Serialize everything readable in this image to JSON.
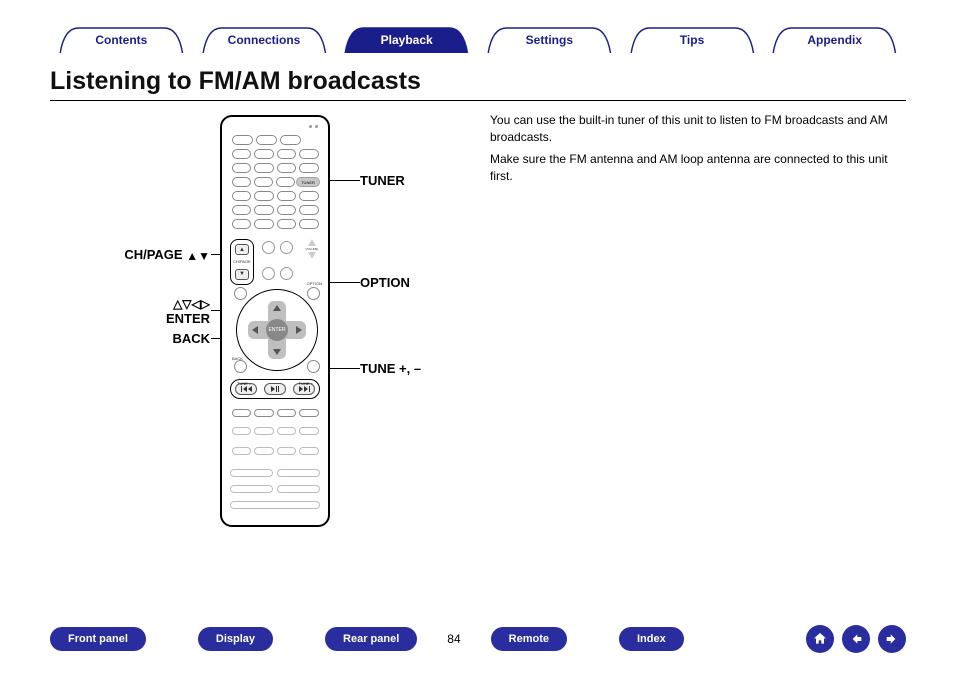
{
  "tabs": {
    "contents": "Contents",
    "connections": "Connections",
    "playback": "Playback",
    "settings": "Settings",
    "tips": "Tips",
    "appendix": "Appendix",
    "active": "playback"
  },
  "heading": "Listening to FM/AM broadcasts",
  "body": {
    "p1": "You can use the built-in tuner of this unit to listen to FM broadcasts and AM broadcasts.",
    "p2": "Make sure the FM antenna and AM loop antenna are connected to this unit first."
  },
  "callouts": {
    "tuner": "TUNER",
    "option": "OPTION",
    "tune": "TUNE +, –",
    "chpage": "CH/PAGE",
    "enter": "ENTER",
    "back": "BACK"
  },
  "remote": {
    "tuner_btn": "TUNER",
    "chpage_label": "CH/PAGE",
    "enter_label": "ENTER",
    "option_label": "OPTION",
    "back_label": "BACK",
    "tune_minus": "TUNE –",
    "tune_plus": "TUNE +"
  },
  "bottom_nav": {
    "front_panel": "Front panel",
    "display": "Display",
    "rear_panel": "Rear panel",
    "remote": "Remote",
    "index": "Index"
  },
  "page_number": "84"
}
